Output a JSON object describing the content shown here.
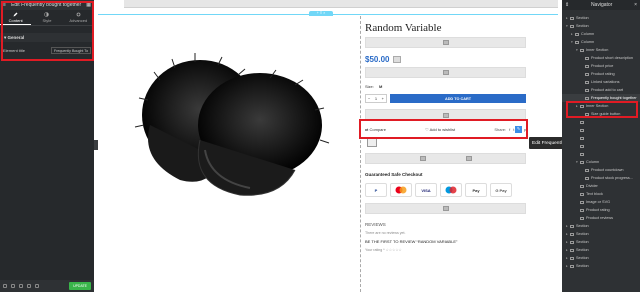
{
  "left_panel": {
    "title": "Edit Frequently bought together",
    "tabs": [
      {
        "label": "Content",
        "icon": "pencil-icon"
      },
      {
        "label": "Style",
        "icon": "half-circle-icon"
      },
      {
        "label": "Advanced",
        "icon": "gear-icon"
      }
    ],
    "section": "General",
    "field_label": "Element title",
    "field_value": "Frequently Bought Tog",
    "update_label": "UPDATE"
  },
  "product": {
    "title": "Random Variable",
    "price": "$50.00",
    "size_label": "Size:",
    "size_value": "M",
    "qty": "1",
    "add_to_cart": "ADD TO CART",
    "compare": "Compare",
    "wishlist": "Add to wishlist",
    "share": "Share:",
    "guarantee": "Guaranteed Safe Checkout",
    "payments": [
      "P",
      "",
      "VISA",
      "",
      "Pay",
      "G Pay"
    ],
    "reviews_title": "REVIEWS",
    "no_reviews": "There are no reviews yet.",
    "first_review": "BE THE FIRST TO REVIEW “RANDOM VARIABLE”",
    "rating_label": "Your rating *"
  },
  "tooltip": "Edit Frequently bought together",
  "navigator": {
    "title": "Navigator",
    "items": [
      {
        "label": "Section",
        "lvl": 0,
        "arrow": "▸"
      },
      {
        "label": "Section",
        "lvl": 0,
        "arrow": "▾"
      },
      {
        "label": "Column",
        "lvl": 1,
        "arrow": "▸"
      },
      {
        "label": "Column",
        "lvl": 1,
        "arrow": "▾"
      },
      {
        "label": "Inner Section",
        "lvl": 2,
        "arrow": "▾"
      },
      {
        "label": "Product short description",
        "lvl": 3,
        "arrow": ""
      },
      {
        "label": "Product price",
        "lvl": 3,
        "arrow": ""
      },
      {
        "label": "Product rating",
        "lvl": 3,
        "arrow": ""
      },
      {
        "label": "Linked variations",
        "lvl": 3,
        "arrow": ""
      },
      {
        "label": "Product add to cart",
        "lvl": 3,
        "arrow": ""
      },
      {
        "label": "Frequently bought together",
        "lvl": 3,
        "arrow": "",
        "highlight": true
      },
      {
        "label": "Inner Section",
        "lvl": 2,
        "arrow": "▸"
      },
      {
        "label": "Size guide button",
        "lvl": 3,
        "arrow": ""
      },
      {
        "label": "",
        "lvl": 2,
        "arrow": ""
      },
      {
        "label": "",
        "lvl": 2,
        "arrow": ""
      },
      {
        "label": "",
        "lvl": 2,
        "arrow": ""
      },
      {
        "label": "",
        "lvl": 2,
        "arrow": ""
      },
      {
        "label": "",
        "lvl": 2,
        "arrow": ""
      },
      {
        "label": "Column",
        "lvl": 2,
        "arrow": "▾"
      },
      {
        "label": "Product countdown",
        "lvl": 3,
        "arrow": ""
      },
      {
        "label": "Product stock progress...",
        "lvl": 3,
        "arrow": ""
      },
      {
        "label": "Divider",
        "lvl": 2,
        "arrow": ""
      },
      {
        "label": "Text block",
        "lvl": 2,
        "arrow": ""
      },
      {
        "label": "Image or SVG",
        "lvl": 2,
        "arrow": ""
      },
      {
        "label": "Product rating",
        "lvl": 2,
        "arrow": ""
      },
      {
        "label": "Product reviews",
        "lvl": 2,
        "arrow": ""
      },
      {
        "label": "Section",
        "lvl": 0,
        "arrow": "▸"
      },
      {
        "label": "Section",
        "lvl": 0,
        "arrow": "▸"
      },
      {
        "label": "Section",
        "lvl": 0,
        "arrow": "▸"
      },
      {
        "label": "Section",
        "lvl": 0,
        "arrow": "▸"
      },
      {
        "label": "Section",
        "lvl": 0,
        "arrow": "▸"
      },
      {
        "label": "Section",
        "lvl": 0,
        "arrow": "▸"
      }
    ]
  },
  "colors": {
    "accent": "#2a6bc7",
    "highlight_box": "#e01b24",
    "panel": "#26292c"
  }
}
